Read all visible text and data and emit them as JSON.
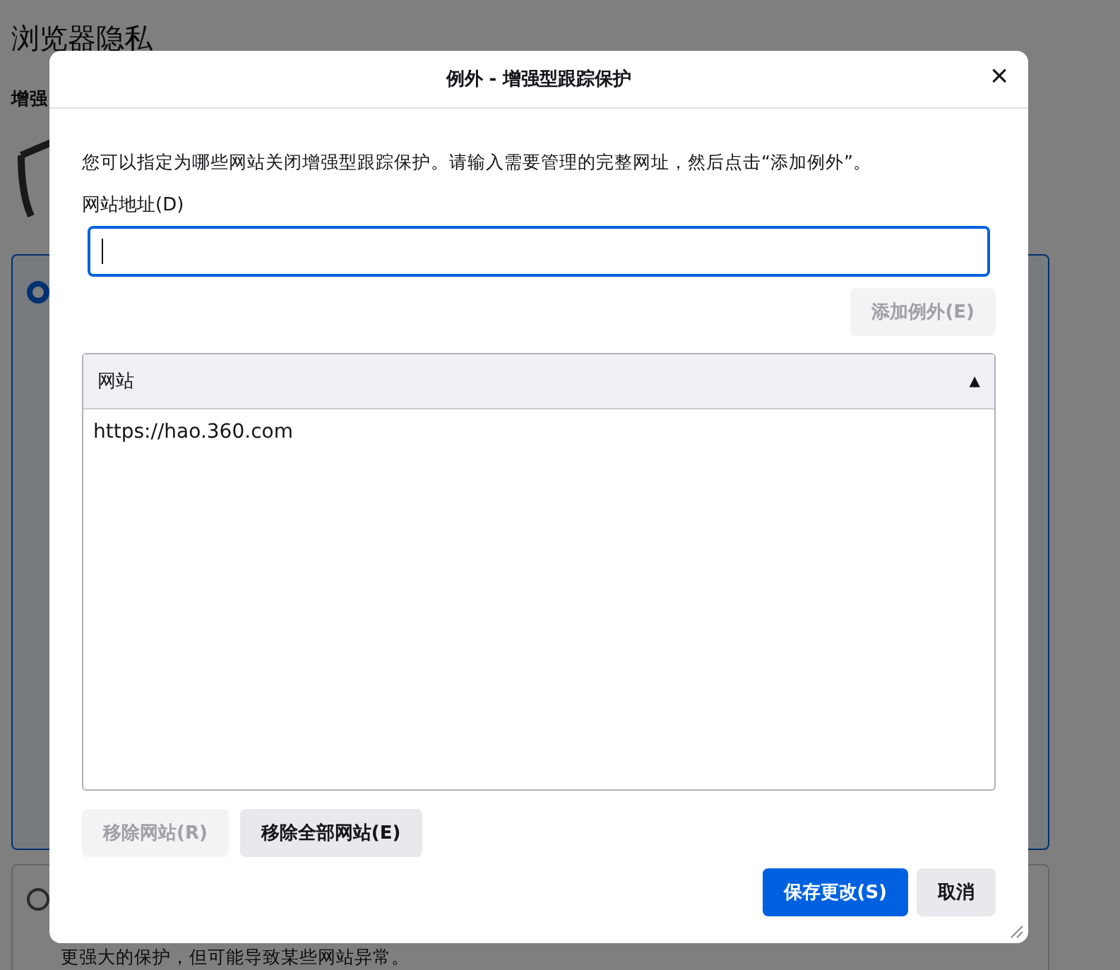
{
  "background_page": {
    "heading": "浏览器隐私",
    "section_title": "增强",
    "options": [
      {
        "selected": true
      },
      {
        "selected": false,
        "description": "更强大的保护，但可能导致某些网站异常。"
      }
    ]
  },
  "dialog": {
    "title": "例外 - 增强型跟踪保护",
    "close": "×",
    "description": "您可以指定为哪些网站关闭增强型跟踪保护。请输入需要管理的完整网址，然后点击“添加例外”。",
    "address_label": "网站地址(D)",
    "add_button": {
      "label": "添加例外(E)",
      "disabled": true
    },
    "table": {
      "columns": [
        {
          "label": "网站",
          "sort": "▲"
        }
      ],
      "rows": [
        "https://hao.360.com"
      ]
    },
    "remove_buttons": [
      {
        "label": "移除网站(R)",
        "disabled": true
      },
      {
        "label": "移除全部网站(E)",
        "disabled": false
      }
    ],
    "footer_buttons": [
      {
        "label": "保存更改(S)",
        "kind": "primary"
      },
      {
        "label": "取消",
        "kind": "secondary"
      }
    ]
  }
}
